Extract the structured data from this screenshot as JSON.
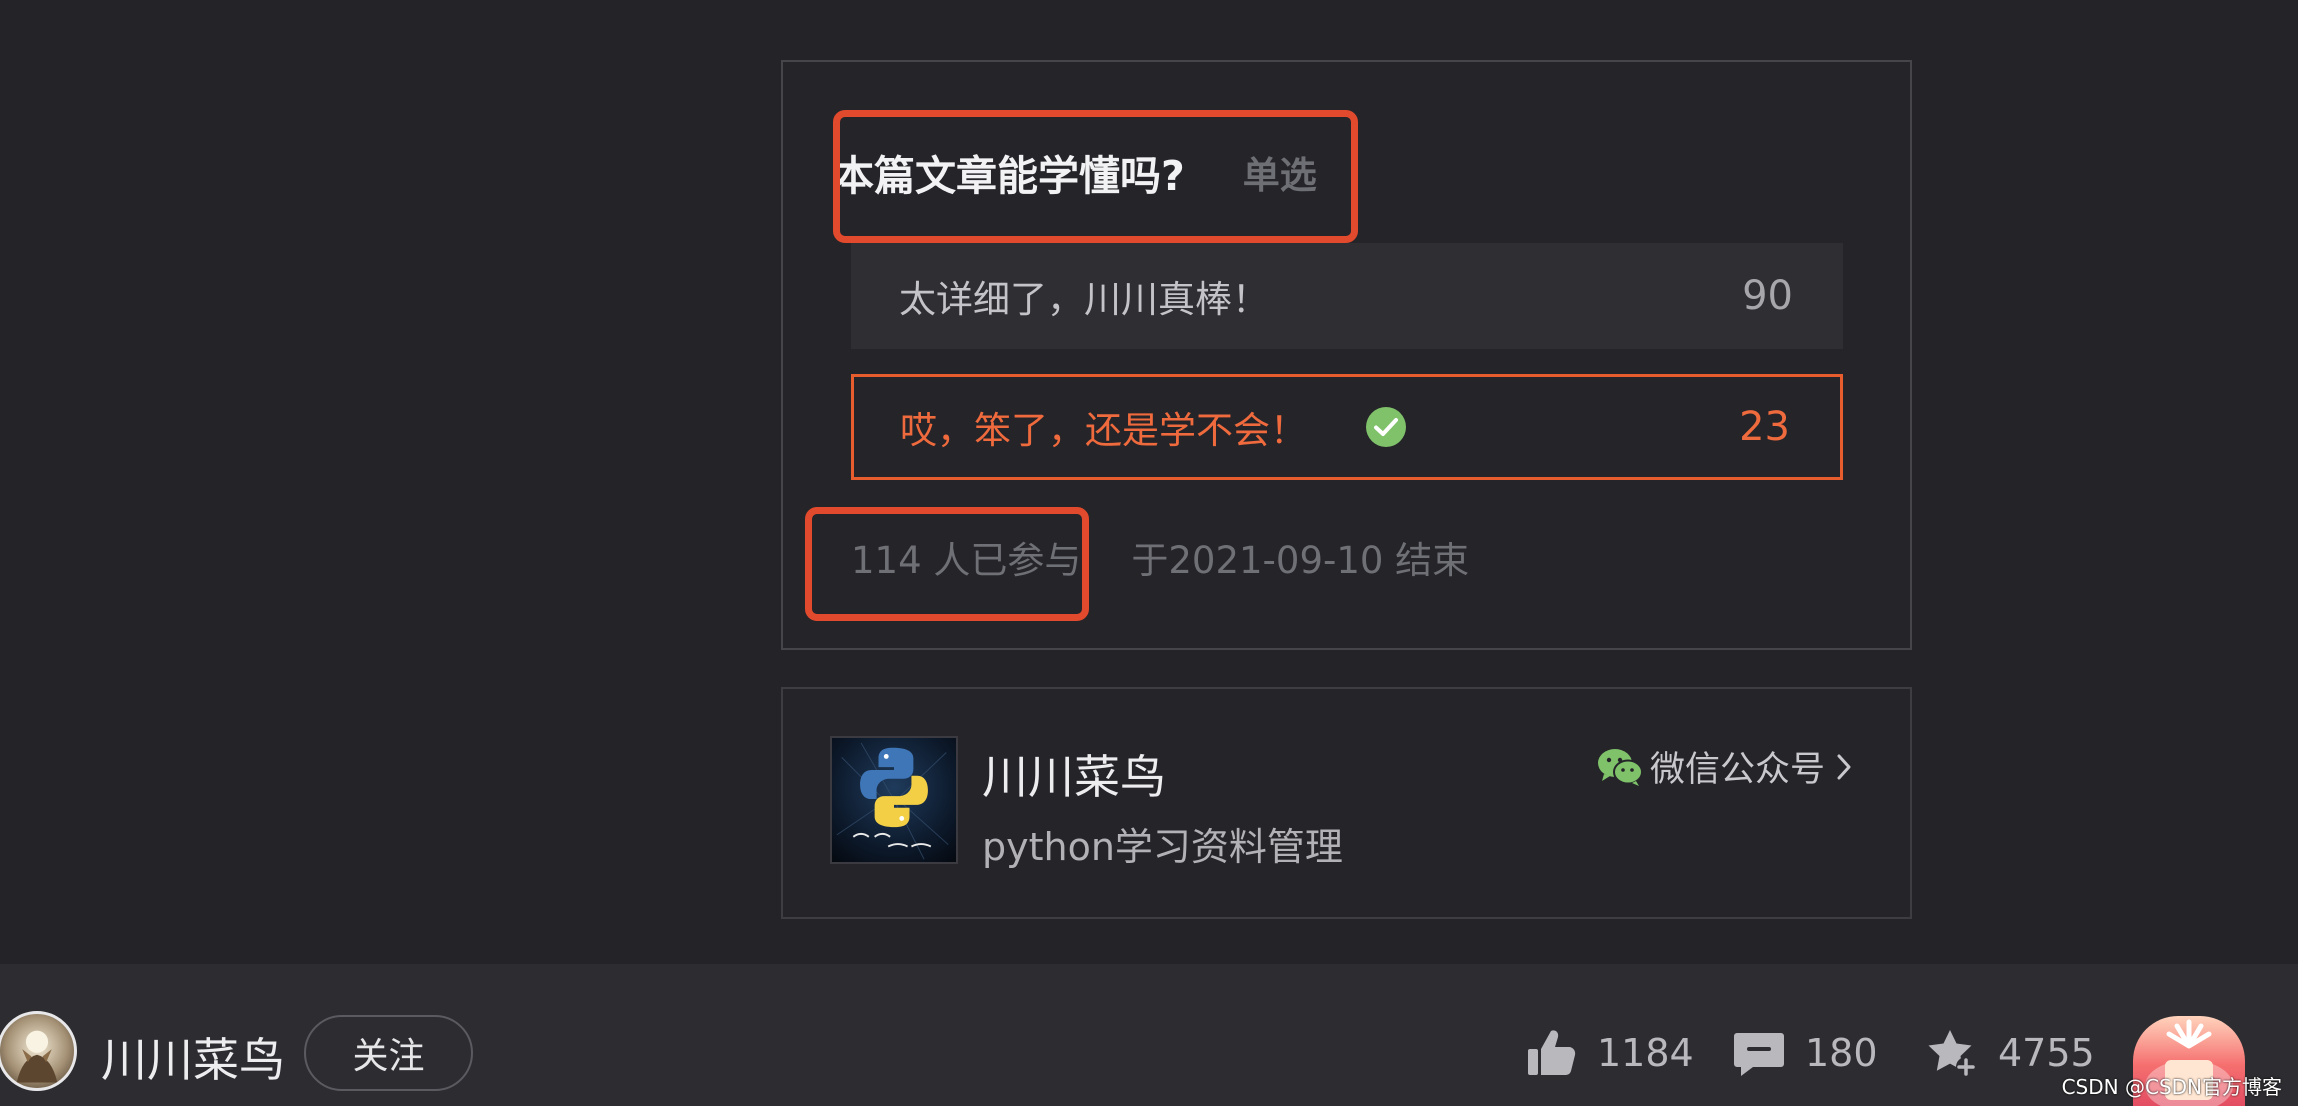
{
  "vote": {
    "title": "本篇文章能学懂吗?",
    "type": "单选",
    "options": [
      {
        "label": "太详细了，川川真棒！",
        "count": "90",
        "selected": false
      },
      {
        "label": "哎，笨了，还是学不会！",
        "count": "23",
        "selected": true
      }
    ],
    "participants": "114 人已参与",
    "end_text": "于2021-09-10 结束"
  },
  "account": {
    "name": "川川菜鸟",
    "description": "python学习资料管理",
    "link_label": "微信公众号",
    "avatar_icon": "python-logo-icon"
  },
  "bottom_bar": {
    "author_name": "川川菜鸟",
    "follow_label": "关注",
    "likes": "1184",
    "comments": "180",
    "favorites": "4755",
    "reward_icon": "reward-icon"
  },
  "watermark": "CSDN @CSDN官方博客",
  "colors": {
    "background": "#242428",
    "accent": "#e85d2e",
    "highlight_box": "#e14a2c",
    "check": "#7fc26a",
    "wechat": "#7fc26a"
  }
}
